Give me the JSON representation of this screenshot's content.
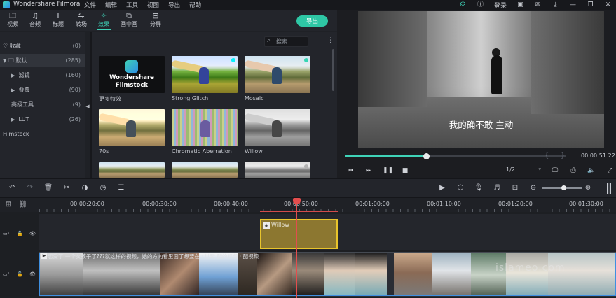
{
  "titlebar": {
    "app_title": "Wondershare Filmora",
    "menu": [
      "文件",
      "编辑",
      "工具",
      "视图",
      "导出",
      "帮助"
    ],
    "login": "登录"
  },
  "media_tabs": [
    {
      "label": "视频",
      "icon": "folder-icon"
    },
    {
      "label": "音频",
      "icon": "music-icon"
    },
    {
      "label": "标题",
      "icon": "text-icon"
    },
    {
      "label": "转场",
      "icon": "transition-icon"
    },
    {
      "label": "效果",
      "icon": "effects-icon",
      "active": true
    },
    {
      "label": "画中画",
      "icon": "pip-icon"
    },
    {
      "label": "分屏",
      "icon": "splitscreen-icon"
    }
  ],
  "export_label": "导出",
  "categories": [
    {
      "label": "收藏",
      "count": "(0)",
      "icon": "heart-icon"
    },
    {
      "label": "默认",
      "count": "(285)",
      "icon": "folder-icon",
      "selected": true
    },
    {
      "label": "滤镜",
      "count": "(160)"
    },
    {
      "label": "叠覆",
      "count": "(90)"
    },
    {
      "label": "高级工具",
      "count": "(9)"
    },
    {
      "label": "LUT",
      "count": "(26)"
    },
    {
      "label": "Filmstock",
      "count": ""
    }
  ],
  "search": {
    "placeholder": "搜索"
  },
  "effects": [
    {
      "label": "更多特效",
      "brand1": "Wondershare",
      "brand2": "Filmstock"
    },
    {
      "label": "Strong Glitch"
    },
    {
      "label": "Mosaic"
    },
    {
      "label": "70s"
    },
    {
      "label": "Chromatic Aberration"
    },
    {
      "label": "Willow"
    }
  ],
  "preview": {
    "subtitle": "我的确不敢 主动",
    "timecode": "00:00:51:22",
    "progress_fraction": 0.37,
    "scale": "1/2"
  },
  "ruler_labels": [
    "00:00:20:00",
    "00:00:30:00",
    "00:00:40:00",
    "00:00:50:00",
    "00:01:00:00",
    "00:01:10:00",
    "00:01:20:00",
    "00:01:30:00"
  ],
  "effect_clip": {
    "label": "Willow"
  },
  "video_clip": {
    "title": "恋爱了 一个女孩子了???就这样的视频，她的方向看里面了想要在 · 世玩 配的视频 · 配视频"
  },
  "watermark": "islameo.com",
  "colors": {
    "accent": "#3fd3b8",
    "playhead": "#e34d4d",
    "effect_clip": "#8c7730"
  }
}
